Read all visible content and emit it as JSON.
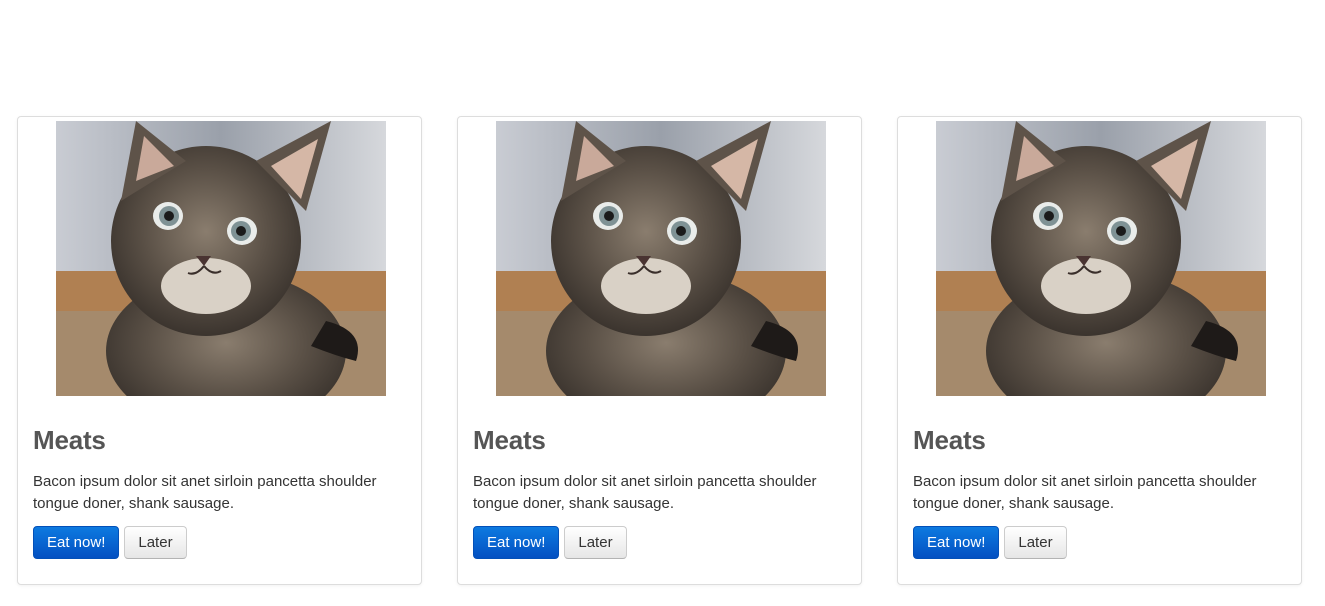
{
  "cards": [
    {
      "image_alt": "kitten",
      "title": "Meats",
      "text": "Bacon ipsum dolor sit anet sirloin pancetta shoulder tongue doner, shank sausage.",
      "primary_button": "Eat now!",
      "secondary_button": "Later"
    },
    {
      "image_alt": "kitten",
      "title": "Meats",
      "text": "Bacon ipsum dolor sit anet sirloin pancetta shoulder tongue doner, shank sausage.",
      "primary_button": "Eat now!",
      "secondary_button": "Later"
    },
    {
      "image_alt": "kitten",
      "title": "Meats",
      "text": "Bacon ipsum dolor sit anet sirloin pancetta shoulder tongue doner, shank sausage.",
      "primary_button": "Eat now!",
      "secondary_button": "Later"
    }
  ],
  "colors": {
    "primary_button": "#0a6ad6",
    "heading": "#555555",
    "body_text": "#333333",
    "border": "#dddddd"
  }
}
